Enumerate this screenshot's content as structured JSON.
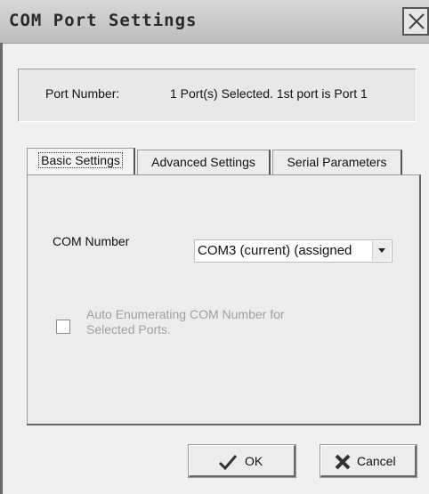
{
  "window": {
    "title": "COM Port Settings",
    "close_icon": "close-icon"
  },
  "port_info": {
    "label": "Port Number:",
    "value": "1 Port(s) Selected. 1st port is Port 1"
  },
  "tabs": [
    {
      "label": "Basic Settings",
      "active": true
    },
    {
      "label": "Advanced Settings",
      "active": false
    },
    {
      "label": "Serial Parameters",
      "active": false
    }
  ],
  "basic": {
    "com_label": "COM Number",
    "com_value": "COM3 (current) (assigned",
    "auto_enum_label": "Auto Enumerating COM Number for Selected Ports.",
    "auto_enum_checked": false,
    "auto_enum_enabled": false
  },
  "buttons": {
    "ok_label": "OK",
    "ok_icon": "checkmark-icon",
    "cancel_label": "Cancel",
    "cancel_icon": "x-icon"
  }
}
